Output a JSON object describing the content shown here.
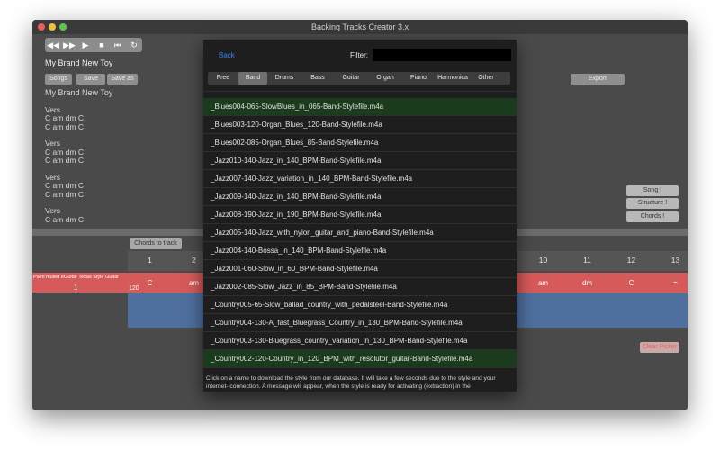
{
  "window": {
    "title": "Backing Tracks Creator 3.x"
  },
  "transport": {
    "buttons": [
      "rewind-icon",
      "fast-forward-icon",
      "play-icon",
      "stop-icon",
      "previous-icon",
      "loop-icon"
    ]
  },
  "song": {
    "name": "My Brand New Toy"
  },
  "toolbar": {
    "songs": "Songs",
    "save": "Save",
    "save_as": "Save as",
    "export": "Export"
  },
  "lyrics": {
    "lines": [
      "My Brand New Toy",
      "",
      "Vers",
      "C am dm C",
      "C am dm C",
      "",
      "Vers",
      "C am dm C",
      "C am dm C",
      "",
      "Vers",
      "C am dm C",
      "C am dm C",
      "",
      "Vers",
      "C am dm C"
    ]
  },
  "side_buttons": {
    "song": "Song !",
    "structure": "Structure !",
    "chords": "Chords !"
  },
  "track": {
    "chords_to_track": "Chords to track",
    "columns": [
      "1",
      "2",
      "10",
      "11",
      "12",
      "13"
    ],
    "name": "Palm muted eGuitar Texas Style Guitar",
    "value": "1",
    "tempo": "120",
    "chords": [
      "C",
      "am",
      "am",
      "dm",
      "C",
      "="
    ]
  },
  "clear_button": "Clear Picker",
  "picker": {
    "back": "Back",
    "filter_label": "Filter:",
    "filter_value": "",
    "tabs": [
      "Free",
      "Band",
      "Drums",
      "Bass",
      "Guitar",
      "Organ",
      "Piano",
      "Harmonica",
      "Other"
    ],
    "active_tab": "Band",
    "items": [
      "_Blues004-065-SlowBlues_in_065-Band-Stylefile.m4a",
      "_Blues003-120-Organ_Blues_120-Band-Stylefile.m4a",
      "_Blues002-085-Organ_Blues_85-Band-Stylefile.m4a",
      "_Jazz010-140-Jazz_in_140_BPM-Band-Stylefile.m4a",
      "_Jazz007-140-Jazz_variation_in_140_BPM-Band-Stylefile.m4a",
      "_Jazz009-140-Jazz_in_140_BPM-Band-Stylefile.m4a",
      "_Jazz008-190-Jazz_in_190_BPM-Band-Stylefile.m4a",
      "_Jazz005-140-Jazz_with_nylon_guitar_and_piano-Band-Stylefile.m4a",
      "_Jazz004-140-Bossa_in_140_BPM-Band-Stylefile.m4a",
      "_Jazz001-060-Slow_in_60_BPM-Band-Stylefile.m4a",
      "_Jazz002-085-Slow_Jazz_in_85_BPM-Band-Stylefile.m4a",
      "_Country005-65-Slow_ballad_country_with_pedalsteel-Band-Stylefile.m4a",
      "_Country004-130-A_fast_Bluegrass_Country_in_130_BPM-Band-Stylefile.m4a",
      "_Country003-130-Bluegrass_country_variation_in_130_BPM-Band-Stylefile.m4a",
      "_Country002-120-Country_in_120_BPM_with_resolutor_guitar-Band-Stylefile.m4a"
    ],
    "footer": "Click on a name to download the style from our database.  It will take a few seconds due to the style and your internet- connection. A message will appear, when the style is ready for activating (extraction) in the"
  }
}
